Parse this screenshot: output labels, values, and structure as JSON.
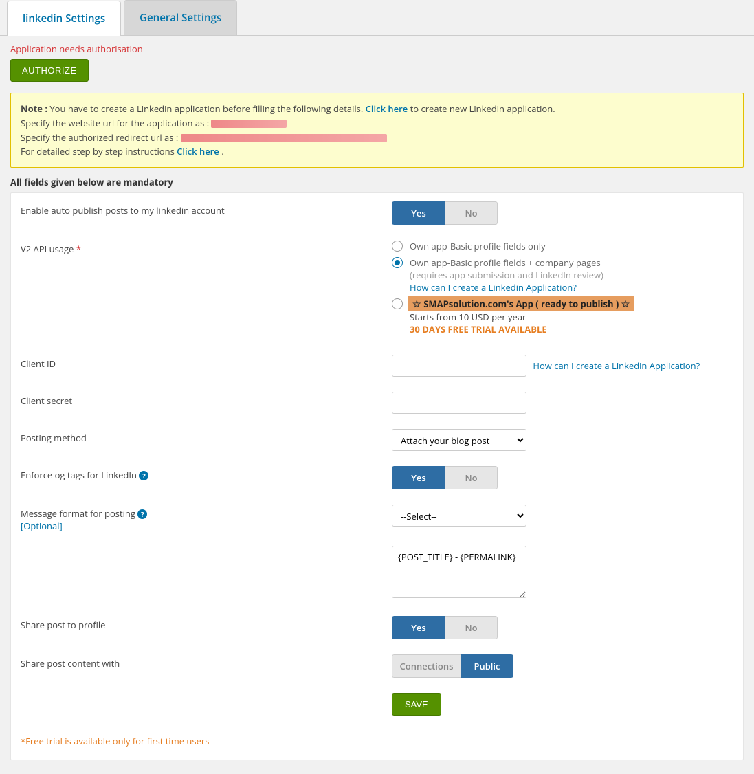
{
  "tabs": {
    "linkedin": "linkedin Settings",
    "general": "General Settings"
  },
  "auth": {
    "message": "Application needs authorisation",
    "button": "AUTHORIZE"
  },
  "note": {
    "label": "Note : ",
    "line1a": "You have to create a Linkedin application before filling the following details. ",
    "line1_link": "Click here",
    "line1b": " to create new Linkedin application.",
    "line2a": "Specify the website url for the application as : ",
    "line3a": "Specify the authorized redirect url as : ",
    "line4a": "For detailed step by step instructions ",
    "line4_link": "Click here",
    "line4b": "."
  },
  "mandatory_heading": "All fields given below are mandatory",
  "toggle": {
    "yes": "Yes",
    "no": "No"
  },
  "fields": {
    "auto_publish": "Enable auto publish posts to my linkedin account",
    "v2_api": "V2 API usage",
    "v2_opt1": "Own app-Basic profile fields only",
    "v2_opt2a": "Own app-Basic profile fields + company pages",
    "v2_opt2b": "(requires app submission and LinkedIn review)",
    "v2_create_link": "How can I create a Linkedin Application?",
    "v2_opt3_label": "SMAPsolution.com's App ( ready to publish )",
    "v2_opt3_sub": "Starts from 10 USD per year",
    "v2_opt3_promo": "30 DAYS FREE TRIAL AVAILABLE",
    "client_id": "Client ID",
    "client_secret": "Client secret",
    "posting_method": "Posting method",
    "posting_method_value": "Attach your blog post",
    "enforce_og": "Enforce og tags for LinkedIn",
    "msg_format": "Message format for posting",
    "optional": "[Optional]",
    "msg_select_value": "--Select--",
    "msg_textarea": "{POST_TITLE} - {PERMALINK}",
    "share_profile": "Share post to profile",
    "share_content": "Share post content with",
    "connections": "Connections",
    "public": "Public",
    "save": "SAVE"
  },
  "footer_note": "*Free trial is available only for first time users"
}
